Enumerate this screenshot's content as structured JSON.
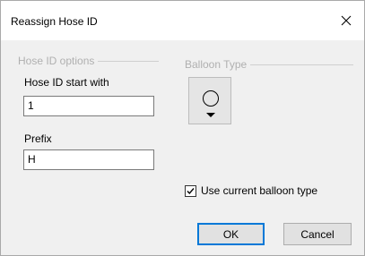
{
  "dialog": {
    "title": "Reassign Hose ID",
    "close_icon": "close-icon"
  },
  "hose_id_options": {
    "legend": "Hose ID options",
    "start_label": "Hose ID start with",
    "start_value": "1",
    "prefix_label": "Prefix",
    "prefix_value": "H"
  },
  "balloon_type": {
    "legend": "Balloon Type",
    "icon": "circle-balloon-dropdown-icon"
  },
  "use_current": {
    "label": "Use current balloon type",
    "checked": true
  },
  "buttons": {
    "ok": "OK",
    "cancel": "Cancel"
  },
  "colors": {
    "accent": "#0078d7",
    "disabled_text": "#b0b0b0",
    "window_bg": "#f0f0f0"
  }
}
